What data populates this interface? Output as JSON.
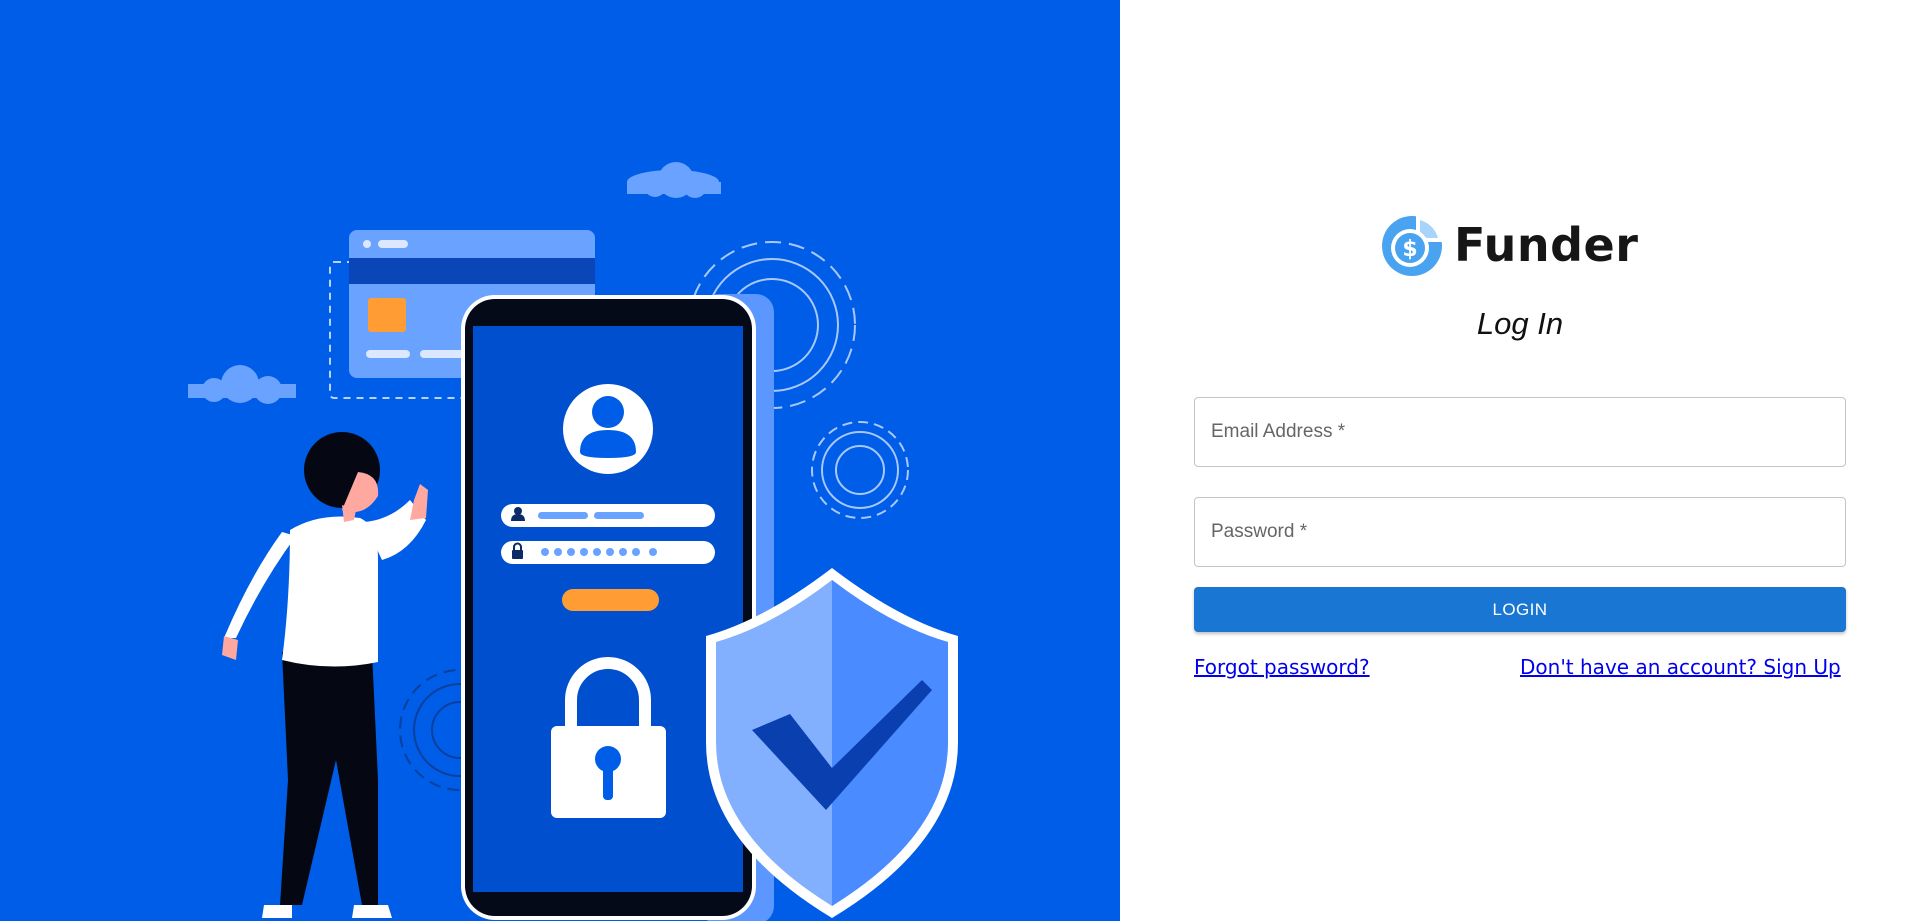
{
  "brand": {
    "name": "Funder",
    "logo_icon": "dollar-chart-icon"
  },
  "login_form": {
    "title": "Log In",
    "email_placeholder": "Email Address *",
    "password_placeholder": "Password *",
    "login_label": "LOGIN",
    "forgot_link": "Forgot password?",
    "signup_link": "Don't have an account? Sign Up"
  },
  "illustration": {
    "icons": [
      "cloud-icon",
      "credit-card-icon",
      "gear-icon",
      "smartphone-icon",
      "user-avatar-icon",
      "padlock-icon",
      "shield-check-icon",
      "person-figure"
    ]
  },
  "colors": {
    "hero_background": "#005de8",
    "accent_blue": "#1976d2",
    "link": "#0000ee",
    "logo_blue": "#4aa3f0"
  }
}
